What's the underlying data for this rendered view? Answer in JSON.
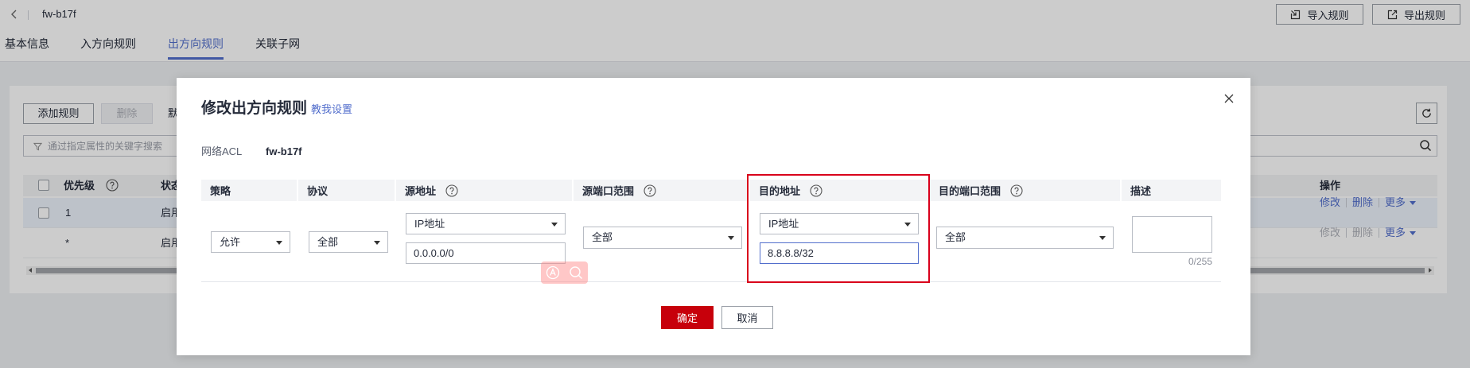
{
  "header": {
    "title": "fw-b17f",
    "back_icon": "chevron-left-icon",
    "import_button": {
      "label": "导入规则",
      "icon": "import-icon"
    },
    "export_button": {
      "label": "导出规则",
      "icon": "export-icon"
    }
  },
  "tabs": [
    {
      "label": "基本信息",
      "active": false
    },
    {
      "label": "入方向规则",
      "active": false
    },
    {
      "label": "出方向规则",
      "active": true
    },
    {
      "label": "关联子网",
      "active": false
    }
  ],
  "toolbar": {
    "add_rule_label": "添加规则",
    "delete_label": "删除",
    "partial_label": "默",
    "refresh_icon": "refresh-icon"
  },
  "search": {
    "placeholder": "通过指定属性的关键字搜索",
    "filter_icon": "filter-icon",
    "search_icon": "search-icon"
  },
  "rules_table": {
    "columns": {
      "priority": "优先级",
      "status": "状态",
      "actions": "操作"
    },
    "rows": [
      {
        "priority": "1",
        "status": "启用",
        "actions": {
          "edit": "修改",
          "delete": "删除",
          "more": "更多"
        }
      },
      {
        "priority": "*",
        "status": "启用",
        "actions": {
          "edit": "修改",
          "delete": "删除",
          "more": "更多"
        }
      }
    ]
  },
  "modal": {
    "title": "修改出方向规则",
    "help_link": "教我设置",
    "acl_label": "网络ACL",
    "acl_value": "fw-b17f",
    "columns": {
      "policy": "策略",
      "protocol": "协议",
      "source_address": "源地址",
      "source_port_range": "源端口范围",
      "destination_address": "目的地址",
      "destination_port_range": "目的端口范围",
      "description": "描述"
    },
    "rule": {
      "policy": "允许",
      "protocol": "全部",
      "source_address_type": "IP地址",
      "source_address": "0.0.0.0/0",
      "source_port_range": "全部",
      "destination_address_type": "IP地址",
      "destination_address": "8.8.8.8/32",
      "destination_port_range": "全部",
      "description": "",
      "description_counter": "0/255"
    },
    "confirm_label": "确定",
    "cancel_label": "取消"
  },
  "colors": {
    "accent": "#526ecc",
    "primary_button": "#c7000b",
    "highlight_box": "#d9001b",
    "mask": "rgba(0,0,0,0.2)"
  }
}
